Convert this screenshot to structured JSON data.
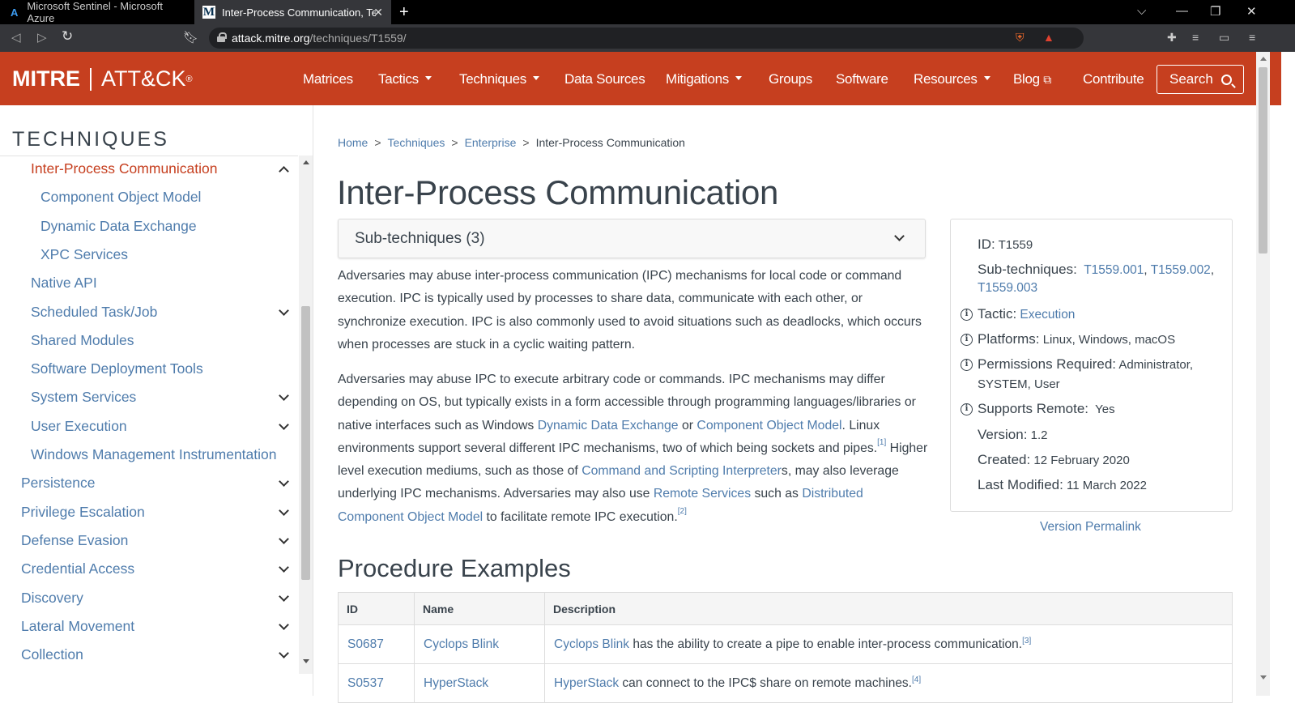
{
  "browser": {
    "tabs": [
      {
        "title": "Microsoft Sentinel - Microsoft Azure",
        "icon": "azure-icon"
      },
      {
        "title": "Inter-Process Communication, Te",
        "icon": "mitre-icon"
      }
    ],
    "url_host": "attack.mitre.org",
    "url_path": "/techniques/T1559/"
  },
  "header": {
    "logo_left": "MITRE",
    "logo_right": "ATT&CK",
    "logo_mark": "®",
    "nav": [
      "Matrices",
      "Tactics",
      "Techniques",
      "Data Sources",
      "Mitigations",
      "Groups",
      "Software",
      "Resources",
      "Blog",
      "Contribute"
    ],
    "search_label": "Search"
  },
  "sidebar": {
    "title": "TECHNIQUES",
    "items": [
      {
        "label": "Inter-Process Communication",
        "level": 1,
        "state": "active-expanded"
      },
      {
        "label": "Component Object Model",
        "level": 2
      },
      {
        "label": "Dynamic Data Exchange",
        "level": 2
      },
      {
        "label": "XPC Services",
        "level": 2
      },
      {
        "label": "Native API",
        "level": 1
      },
      {
        "label": "Scheduled Task/Job",
        "level": 1,
        "state": "collapsed"
      },
      {
        "label": "Shared Modules",
        "level": 1
      },
      {
        "label": "Software Deployment Tools",
        "level": 1
      },
      {
        "label": "System Services",
        "level": 1,
        "state": "collapsed"
      },
      {
        "label": "User Execution",
        "level": 1,
        "state": "collapsed"
      },
      {
        "label": "Windows Management Instrumentation",
        "level": 1
      },
      {
        "label": "Persistence",
        "level": 0,
        "state": "collapsed"
      },
      {
        "label": "Privilege Escalation",
        "level": 0,
        "state": "collapsed"
      },
      {
        "label": "Defense Evasion",
        "level": 0,
        "state": "collapsed"
      },
      {
        "label": "Credential Access",
        "level": 0,
        "state": "collapsed"
      },
      {
        "label": "Discovery",
        "level": 0,
        "state": "collapsed"
      },
      {
        "label": "Lateral Movement",
        "level": 0,
        "state": "collapsed"
      },
      {
        "label": "Collection",
        "level": 0,
        "state": "collapsed"
      }
    ]
  },
  "breadcrumb": [
    "Home",
    "Techniques",
    "Enterprise",
    "Inter-Process Communication"
  ],
  "page": {
    "title": "Inter-Process Communication",
    "subtechniques_label": "Sub-techniques (3)",
    "p1": "Adversaries may abuse inter-process communication (IPC) mechanisms for local code or command execution. IPC is typically used by processes to share data, communicate with each other, or synchronize execution. IPC is also commonly used to avoid situations such as deadlocks, which occurs when processes are stuck in a cyclic waiting pattern.",
    "p2": {
      "t1": "Adversaries may abuse IPC to execute arbitrary code or commands. IPC mechanisms may differ depending on OS, but typically exists in a form accessible through programming languages/libraries or native interfaces such as Windows ",
      "link1": "Dynamic Data Exchange",
      "t2": " or ",
      "link2": "Component Object Model",
      "t3": ". Linux environments support several different IPC mechanisms, two of which being sockets and pipes.",
      "ref1": "[1]",
      "t4": " Higher level execution mediums, such as those of ",
      "link3": "Command and Scripting Interpreter",
      "t5": "s, may also leverage underlying IPC mechanisms. Adversaries may also use ",
      "link4": "Remote Services",
      "t6": " such as ",
      "link5": "Distributed Component Object Model",
      "t7": " to facilitate remote IPC execution.",
      "ref2": "[2]"
    }
  },
  "card": {
    "id_label": "ID:",
    "id_value": "T1559",
    "subtech_label": "Sub-techniques:",
    "subtech_links": [
      "T1559.001",
      "T1559.002",
      "T1559.003"
    ],
    "tactic_label": "Tactic:",
    "tactic_value": "Execution",
    "platforms_label": "Platforms:",
    "platforms_value": "Linux, Windows, macOS",
    "permissions_label": "Permissions Required:",
    "permissions_value_1": "Administrator,",
    "permissions_value_2": "SYSTEM, User",
    "remote_label": "Supports Remote:",
    "remote_value": "Yes",
    "version_label": "Version:",
    "version_value": "1.2",
    "created_label": "Created:",
    "created_value": "12 February 2020",
    "modified_label": "Last Modified:",
    "modified_value": "11 March 2022",
    "permalink": "Version Permalink"
  },
  "procedures": {
    "title": "Procedure Examples",
    "columns": [
      "ID",
      "Name",
      "Description"
    ],
    "rows": [
      {
        "id": "S0687",
        "name": "Cyclops Blink",
        "desc_link": "Cyclops Blink",
        "desc_text": " has the ability to create a pipe to enable inter-process communication.",
        "ref": "[3]"
      },
      {
        "id": "S0537",
        "name": "HyperStack",
        "desc_link": "HyperStack",
        "desc_text": " can connect to the IPC$ share on remote machines.",
        "ref": "[4]"
      }
    ]
  },
  "colors": {
    "brand": "#c63f1f",
    "link": "#4f7cac",
    "text": "#39434c"
  }
}
